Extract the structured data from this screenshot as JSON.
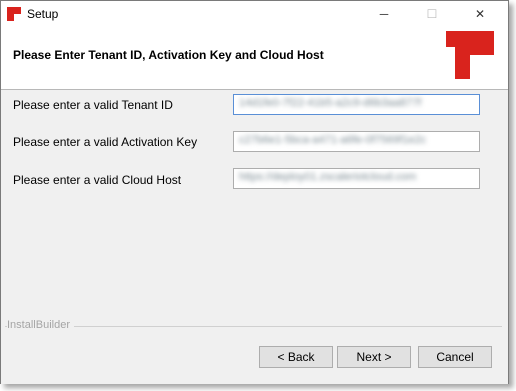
{
  "window": {
    "title": "Setup",
    "minimize_glyph": "─",
    "maximize_glyph": "☐",
    "close_glyph": "✕"
  },
  "header": {
    "title": "Please Enter Tenant ID, Activation Key and Cloud Host",
    "logo_color": "#d9231d"
  },
  "form": {
    "tenant_id_label": "Please enter a valid Tenant ID",
    "tenant_id_value": "14d1fe0-7f22-41b5-a2c9-d6b3aa877f",
    "activation_key_label": "Please enter a valid Activation Key",
    "activation_key_value": "c27b6e1-5bca-a471-a6fe-0f7569f1e2c",
    "cloud_host_label": "Please enter a valid Cloud Host",
    "cloud_host_value": "https://deploy01.zscaleriotcloud.com"
  },
  "footer": {
    "brand": "InstallBuilder",
    "back_label": "< Back",
    "next_label": "Next >",
    "cancel_label": "Cancel"
  }
}
